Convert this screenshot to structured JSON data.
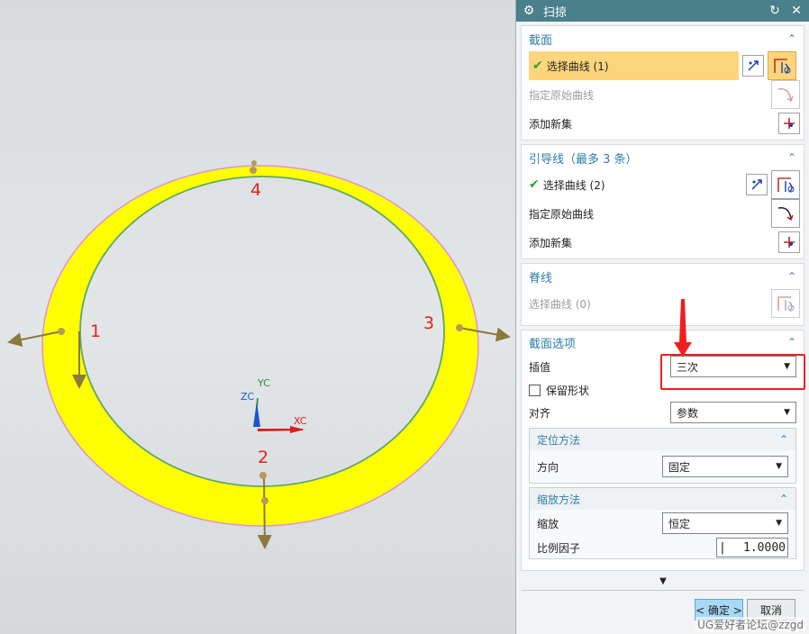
{
  "dialog": {
    "title": "扫掠",
    "section_profile": {
      "title": "截面",
      "select_curve": "选择曲线 (1)",
      "specify_original": "指定原始曲线",
      "add_new_set": "添加新集"
    },
    "section_guide": {
      "title": "引导线（最多 3 条）",
      "select_curve": "选择曲线 (2)",
      "specify_original": "指定原始曲线",
      "add_new_set": "添加新集"
    },
    "section_spine": {
      "title": "脊线",
      "select_curve": "选择曲线 (0)"
    },
    "section_options": {
      "title": "截面选项",
      "interp_label": "插值",
      "interp_value": "三次",
      "preserve_shape": "保留形状",
      "align_label": "对齐",
      "align_value": "参数",
      "orientation": {
        "title": "定位方法",
        "direction_label": "方向",
        "direction_value": "固定"
      },
      "scaling": {
        "title": "缩放方法",
        "scale_label": "缩放",
        "scale_value": "恒定",
        "factor_label": "比例因子",
        "factor_value": "1.0000"
      }
    },
    "ok_label": "< 确定 >",
    "cancel_label": "取消"
  },
  "viewport": {
    "labels": [
      "1",
      "2",
      "3",
      "4"
    ],
    "axis_yc": "YC",
    "axis_zc": "ZC",
    "axis_xc": "XC"
  },
  "watermark": "UG爱好者论坛@zzgd",
  "colors": {
    "ring": "#ffff00",
    "title_bar": "#49808a",
    "highlight": "#fcd57c",
    "annotation": "#ef1f1f",
    "section_title": "#2e7ea8"
  }
}
